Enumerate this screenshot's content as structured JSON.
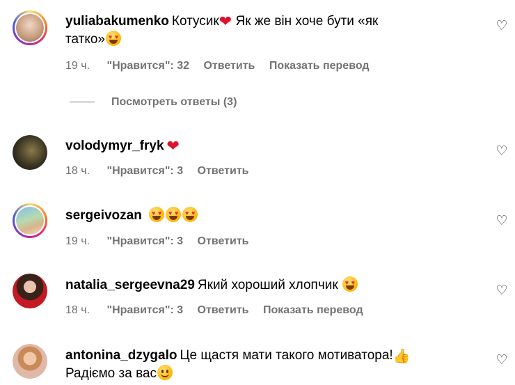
{
  "comments": [
    {
      "username": "yuliabakumenko",
      "text_parts": [
        "Котусик",
        "Як же він хоче бути «як",
        "татко»"
      ],
      "time": "19 ч.",
      "likes": "\"Нравится\": 32",
      "reply": "Ответить",
      "translate": "Показать перевод"
    },
    {
      "username": "volodymyr_fryk",
      "time": "18 ч.",
      "likes": "\"Нравится\": 3",
      "reply": "Ответить"
    },
    {
      "username": "sergeivozan",
      "time": "19 ч.",
      "likes": "\"Нравится\": 3",
      "reply": "Ответить"
    },
    {
      "username": "natalia_sergeevna29",
      "text": "Який хороший хлопчик",
      "time": "18 ч.",
      "likes": "\"Нравится\": 3",
      "reply": "Ответить",
      "translate": "Показать перевод"
    },
    {
      "username": "antonina_dzygalo",
      "text_line1": "Це щастя мати такого мотиватора!",
      "text_line2": "Радіємо за вас"
    }
  ],
  "view_replies": "Посмотреть ответы (3)",
  "icons": {
    "like": "heart-outline-icon",
    "heart_emoji": "red-heart-emoji",
    "heart_eyes_emoji": "heart-eyes-emoji",
    "thumbs_up_emoji": "thumbs-up-emoji",
    "smile_emoji": "smiling-face-emoji"
  },
  "colors": {
    "meta_text": "#737373",
    "heart": "#e0102e",
    "story_ring": [
      "#feda75",
      "#fa7e1e",
      "#d62976",
      "#962fbf",
      "#4f5bd5"
    ]
  }
}
